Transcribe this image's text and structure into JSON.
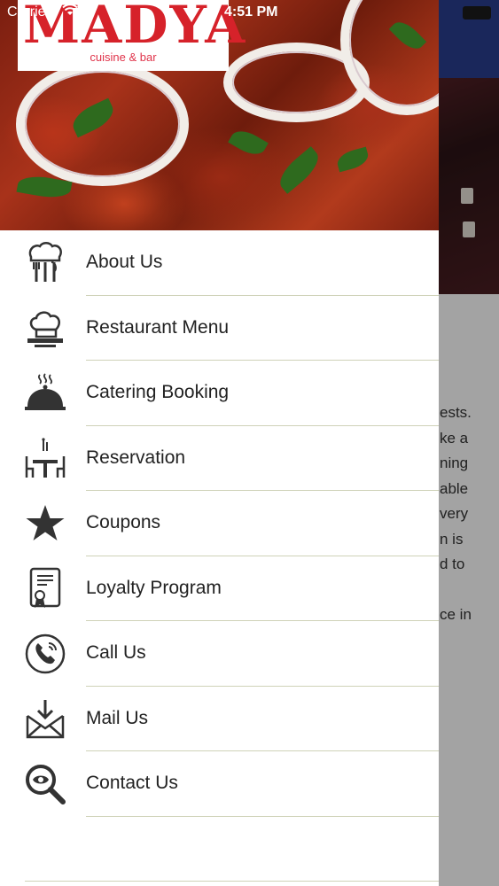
{
  "status_bar": {
    "carrier": "Carrier",
    "time": "4:51 PM"
  },
  "brand": {
    "name": "MADYA",
    "tagline": "cuisine & bar"
  },
  "menu": {
    "items": [
      {
        "label": "About Us",
        "icon": "restaurant-utensils-icon"
      },
      {
        "label": "Restaurant Menu",
        "icon": "chef-hat-icon"
      },
      {
        "label": "Catering Booking",
        "icon": "cloche-icon"
      },
      {
        "label": "Reservation",
        "icon": "dining-table-icon"
      },
      {
        "label": "Coupons",
        "icon": "star-icon"
      },
      {
        "label": "Loyalty Program",
        "icon": "certificate-icon"
      },
      {
        "label": "Call Us",
        "icon": "phone-icon"
      },
      {
        "label": "Mail Us",
        "icon": "mail-download-icon"
      },
      {
        "label": "Contact Us",
        "icon": "search-icon"
      }
    ]
  },
  "background_text": [
    "ests.",
    "ke a",
    "ning",
    "able",
    "very",
    "n  is",
    "d to",
    "",
    "ce in"
  ]
}
